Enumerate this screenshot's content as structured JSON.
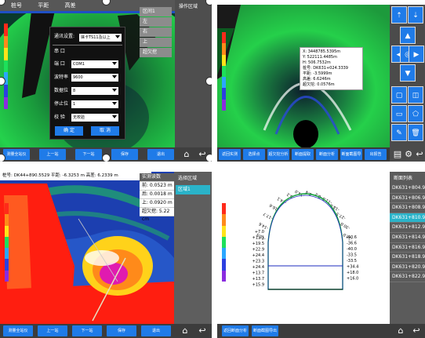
{
  "q1": {
    "menu": [
      "桩号",
      "平距",
      "高差"
    ],
    "side_list": [
      "区间1",
      "左",
      "右",
      "上",
      "超欠挖"
    ],
    "side_title": "操作区域",
    "dialog": {
      "comm_label": "通讯设置:",
      "comm_value": "徕卡TS11及以上",
      "section": "串 口",
      "rows": [
        {
          "label": "端 口",
          "value": "COM1"
        },
        {
          "label": "波特率",
          "value": "9600"
        },
        {
          "label": "数据位",
          "value": "8"
        },
        {
          "label": "停止位",
          "value": "1"
        },
        {
          "label": "校 验",
          "value": "无校验"
        }
      ],
      "ok": "确 定",
      "cancel": "取 消"
    },
    "bottom_buttons": [
      "测量全站仪",
      "上一站",
      "下一站",
      "保存",
      "退出"
    ]
  },
  "q2": {
    "info_lines": [
      "X: 3448785.5395m",
      "Y: 522111.4485m",
      "H: 506.7532m",
      "桩号: DK631+024.3339",
      "平距: -3.5999m",
      "高差: 6.6246m",
      "超欠挖: 0.0576m"
    ],
    "bottom_buttons": [
      "返回实测",
      "选择点",
      "超欠挖分析",
      "断面提取",
      "断面分析",
      "断面截图导出",
      "出报告"
    ]
  },
  "q3": {
    "header": "桩号: DK44+890.5529  平距: -6.3253 m  高差: 6.2339 m",
    "readings_title": "实测读数",
    "readings": [
      "前: 0.0523 m",
      "后: 0.0018 m",
      "上: 0.0920 m",
      "超欠挖: 5.22 cm"
    ],
    "side_title": "选择区域",
    "side_item": "区域1",
    "bottom_buttons": [
      "测量全站仪",
      "上一站",
      "下一站",
      "保存",
      "退出"
    ]
  },
  "q4": {
    "side_title": "断面列表",
    "chainages": [
      "DK631+804.9652",
      "DK631+806.9652",
      "DK631+808.9652",
      "DK631+810.9652",
      "DK631+812.9652",
      "DK631+814.9652",
      "DK631+816.9652",
      "DK631+818.9652",
      "DK631+820.9652",
      "DK631+822.9652"
    ],
    "selected_index": 3,
    "left_labels": [
      "+7.0",
      "+11.1",
      "+19.5",
      "+22.9",
      "+24.4",
      "+23.3",
      "+24.4",
      "+13.7",
      "+13.7",
      "+15.9"
    ],
    "right_labels": [
      "-40.6",
      "-36.6",
      "-40.0",
      "-33.5",
      "-33.5",
      "+34.4",
      "+18.0",
      "+16.0"
    ],
    "top_labels": [
      "-18.5",
      "-14.6",
      "-17.7",
      "-16.6",
      "-14.1",
      "-8.2",
      "-14.0",
      "-5.4",
      "-8.2",
      "-11.0",
      "-18.6",
      "-27.5",
      "-30.8",
      "-33.0"
    ],
    "bottom_buttons": [
      "返回断面分析",
      "断面截图导出"
    ]
  },
  "colors": {
    "accent": "#1f7be8",
    "scan_green": "#22d14a",
    "scan_blue": "#1d4fd8",
    "scan_red": "#ff1e10",
    "panel_gray": "#5e5e5e",
    "selected_row": "#2ab3c9"
  }
}
